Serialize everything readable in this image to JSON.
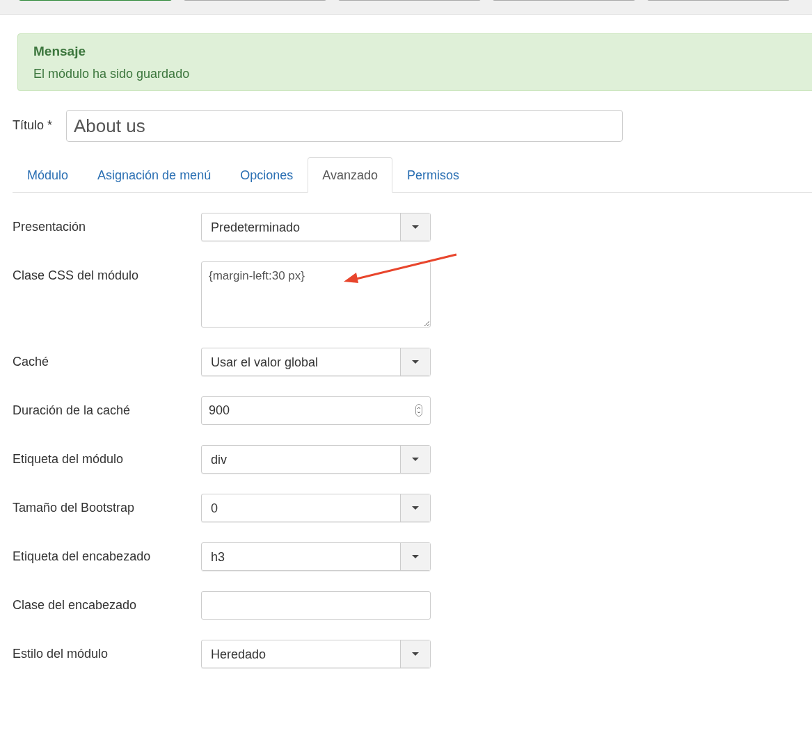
{
  "toolbar": {
    "buttons": [
      {
        "kind": "primary"
      },
      {
        "kind": "default"
      },
      {
        "kind": "default"
      },
      {
        "kind": "default"
      },
      {
        "kind": "default"
      }
    ]
  },
  "message": {
    "heading": "Mensaje",
    "text": "El módulo ha sido guardado"
  },
  "title_field": {
    "label": "Título *",
    "value": "About us"
  },
  "tabs": [
    {
      "label": "Módulo",
      "selected": false
    },
    {
      "label": "Asignación de menú",
      "selected": false
    },
    {
      "label": "Opciones",
      "selected": false
    },
    {
      "label": "Avanzado",
      "selected": true
    },
    {
      "label": "Permisos",
      "selected": false
    }
  ],
  "fields": [
    {
      "label": "Presentación",
      "kind": "select",
      "value": "Predeterminado"
    },
    {
      "label": "Clase CSS del módulo",
      "kind": "textarea",
      "value": "{margin-left:30 px}"
    },
    {
      "label": "Caché",
      "kind": "select",
      "value": "Usar el valor global"
    },
    {
      "label": "Duración de la caché",
      "kind": "number",
      "value": "900"
    },
    {
      "label": "Etiqueta del módulo",
      "kind": "select",
      "value": "div"
    },
    {
      "label": "Tamaño del Bootstrap",
      "kind": "select",
      "value": "0"
    },
    {
      "label": "Etiqueta del encabezado",
      "kind": "select",
      "value": "h3"
    },
    {
      "label": "Clase del encabezado",
      "kind": "text"
    },
    {
      "label": "Estilo del módulo",
      "kind": "select",
      "value": "Heredado"
    }
  ]
}
